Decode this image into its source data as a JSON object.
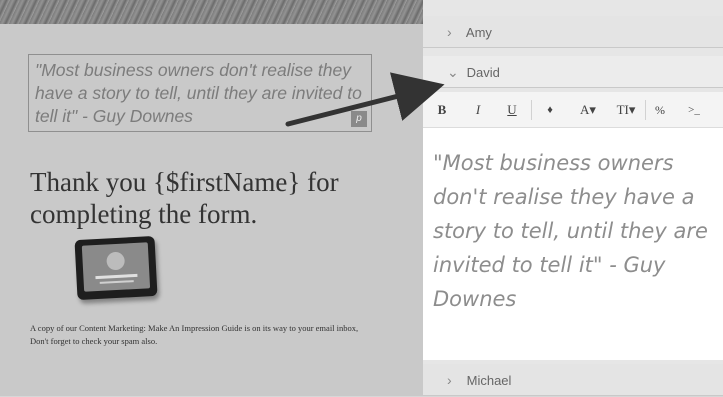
{
  "preview": {
    "quote": "\"Most business owners don't realise they have a story to tell, until they are invited to tell it\" - Guy Downes",
    "edit_badge": "p",
    "thanks_heading": "Thank you {$firstName} for completing the form.",
    "footer_line1": "A copy of our Content Marketing: Make An Impression Guide is on its way to your email inbox,",
    "footer_line2": "Don't forget to check your spam also."
  },
  "panel": {
    "items": [
      {
        "label": "Amy",
        "expanded": false
      },
      {
        "label": "David",
        "expanded": true
      },
      {
        "label": "Michael",
        "expanded": false
      }
    ],
    "toolbar": {
      "bold": "B",
      "italic": "I",
      "underline": "U",
      "ink": "♦",
      "font_color": "A▾",
      "text_size": "TI▾",
      "link": "%",
      "more": ">_"
    },
    "editor_text": "\"Most business owners don't realise they have a story to tell, until they are invited to tell it\" - Guy Downes"
  },
  "icons": {
    "collapsed": "chevron-right-icon",
    "expanded": "chevron-down-icon"
  },
  "colors": {
    "arrow": "#333333",
    "quote_text": "#8d8d8d"
  }
}
